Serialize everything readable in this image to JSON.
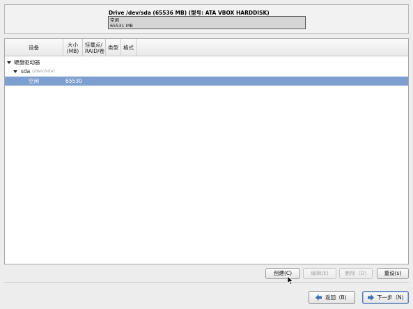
{
  "drive": {
    "title": "Drive /dev/sda (65536 MB) (型号: ATA VBOX HARDDISK)",
    "bar_label": "空闲",
    "bar_size": "65531 MB"
  },
  "columns": {
    "device": "设备",
    "size_line1": "大小",
    "size_line2": "(MB)",
    "mount_line1": "挂载点/",
    "mount_line2": "RAID/卷",
    "type": "类型",
    "format": "格式"
  },
  "tree": {
    "group_label": "硬盘驱动器",
    "disk_name": "sda",
    "disk_path": "(/dev/sda)",
    "free_label": "空闲",
    "free_size": "65530"
  },
  "actions": {
    "create": "创建(C)",
    "edit": "编辑(E)",
    "delete": "删除（D)",
    "reset": "重设(s)"
  },
  "nav": {
    "back": "返回（B)",
    "next": "下一步（N)"
  },
  "colors": {
    "selection": "#7c9fd0",
    "arrow_icon": "#3a6fb0"
  }
}
